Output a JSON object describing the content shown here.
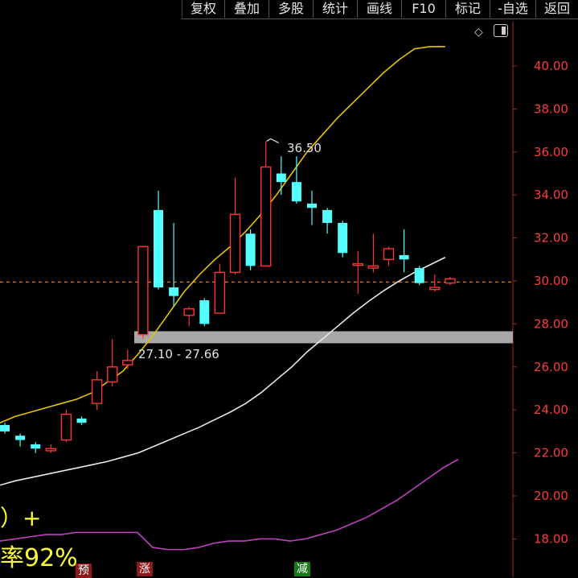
{
  "toolbar": {
    "buttons": [
      "复权",
      "叠加",
      "多股",
      "统计",
      "画线",
      "F10",
      "标记",
      "-自选",
      "返回"
    ]
  },
  "price_axis": {
    "ticks": [
      "40.00",
      "38.00",
      "36.00",
      "34.00",
      "32.00",
      "30.00",
      "28.00",
      "26.00",
      "24.00",
      "22.00",
      "20.00",
      "18.00"
    ]
  },
  "annotations": {
    "high_label": "36.50",
    "zone_label": "27.10 - 27.66"
  },
  "overlay": {
    "paren": "）+",
    "rate_text": "率92%"
  },
  "badges": {
    "yu": "预",
    "zhang": "涨",
    "jian": "减"
  },
  "colors": {
    "up": "#ff3333",
    "down": "#54ffff",
    "ma_short": "#e6c300",
    "ma_long": "#e8e8e8",
    "indicator": "#c040c0",
    "axis_text": "#ff3b3b",
    "ref_line": "#ff8a00"
  },
  "chart_data": {
    "type": "candlestick",
    "y_range": [
      17,
      41.5
    ],
    "reference_price": 29.95,
    "zone": [
      27.1,
      27.66
    ],
    "candles": [
      {
        "o": 23.3,
        "c": 23.0,
        "h": 23.4,
        "l": 22.9
      },
      {
        "o": 22.8,
        "c": 22.6,
        "h": 22.9,
        "l": 22.3
      },
      {
        "o": 22.4,
        "c": 22.2,
        "h": 22.5,
        "l": 22.0
      },
      {
        "o": 22.1,
        "c": 22.2,
        "h": 22.4,
        "l": 22.0
      },
      {
        "o": 22.6,
        "c": 23.8,
        "h": 24.0,
        "l": 22.5
      },
      {
        "o": 23.6,
        "c": 23.4,
        "h": 23.7,
        "l": 23.3
      },
      {
        "o": 24.3,
        "c": 25.4,
        "h": 25.8,
        "l": 24.0
      },
      {
        "o": 25.3,
        "c": 26.0,
        "h": 27.3,
        "l": 25.1
      },
      {
        "o": 26.1,
        "c": 26.3,
        "h": 26.8,
        "l": 25.9
      },
      {
        "o": 27.5,
        "c": 31.6,
        "h": 31.6,
        "l": 27.3
      },
      {
        "o": 33.3,
        "c": 29.7,
        "h": 34.2,
        "l": 29.6
      },
      {
        "o": 29.7,
        "c": 29.3,
        "h": 32.7,
        "l": 28.8
      },
      {
        "o": 28.4,
        "c": 28.7,
        "h": 28.8,
        "l": 27.9
      },
      {
        "o": 29.1,
        "c": 28.0,
        "h": 29.2,
        "l": 27.9
      },
      {
        "o": 28.5,
        "c": 30.4,
        "h": 30.8,
        "l": 28.5
      },
      {
        "o": 30.4,
        "c": 33.1,
        "h": 34.8,
        "l": 30.3
      },
      {
        "o": 32.2,
        "c": 30.7,
        "h": 32.4,
        "l": 30.5
      },
      {
        "o": 30.7,
        "c": 35.3,
        "h": 36.5,
        "l": 30.7
      },
      {
        "o": 35.0,
        "c": 34.6,
        "h": 35.8,
        "l": 34.0
      },
      {
        "o": 34.6,
        "c": 33.7,
        "h": 35.8,
        "l": 33.6
      },
      {
        "o": 33.6,
        "c": 33.4,
        "h": 34.2,
        "l": 32.6
      },
      {
        "o": 33.3,
        "c": 32.7,
        "h": 33.4,
        "l": 32.2
      },
      {
        "o": 32.7,
        "c": 31.3,
        "h": 32.8,
        "l": 31.1
      },
      {
        "o": 30.8,
        "c": 30.8,
        "h": 31.4,
        "l": 29.4
      },
      {
        "o": 30.6,
        "c": 30.7,
        "h": 32.2,
        "l": 30.4
      },
      {
        "o": 31.0,
        "c": 31.5,
        "h": 31.6,
        "l": 30.7
      },
      {
        "o": 31.2,
        "c": 31.0,
        "h": 32.4,
        "l": 30.4
      },
      {
        "o": 30.6,
        "c": 29.9,
        "h": 30.7,
        "l": 29.8
      },
      {
        "o": 29.6,
        "c": 29.7,
        "h": 30.3,
        "l": 29.5
      },
      {
        "o": 29.9,
        "c": 30.1,
        "h": 30.2,
        "l": 29.8
      }
    ],
    "ma_short": [
      23.4,
      23.7,
      23.9,
      24.1,
      24.3,
      24.5,
      24.8,
      25.3,
      25.8,
      26.6,
      27.5,
      28.5,
      29.5,
      30.3,
      31.0,
      31.6,
      32.3,
      33.1,
      34.0,
      35.0,
      36.0,
      36.8,
      37.6,
      38.3,
      39.0,
      39.7,
      40.3,
      40.8,
      40.9,
      40.9
    ],
    "ma_long": [
      20.5,
      20.7,
      20.85,
      21.0,
      21.15,
      21.3,
      21.45,
      21.6,
      21.8,
      22.0,
      22.3,
      22.6,
      22.9,
      23.2,
      23.55,
      23.9,
      24.3,
      24.8,
      25.4,
      26.0,
      26.7,
      27.3,
      27.9,
      28.5,
      29.05,
      29.55,
      30.0,
      30.4,
      30.75,
      31.1
    ],
    "indicator": [
      17.9,
      18.0,
      18.1,
      18.2,
      18.2,
      18.3,
      18.3,
      18.3,
      18.3,
      18.3,
      17.6,
      17.5,
      17.5,
      17.6,
      17.8,
      17.9,
      17.9,
      18.0,
      18.0,
      17.9,
      18.0,
      18.2,
      18.4,
      18.7,
      19.0,
      19.4,
      19.8,
      20.3,
      20.8,
      21.3,
      21.7
    ]
  }
}
